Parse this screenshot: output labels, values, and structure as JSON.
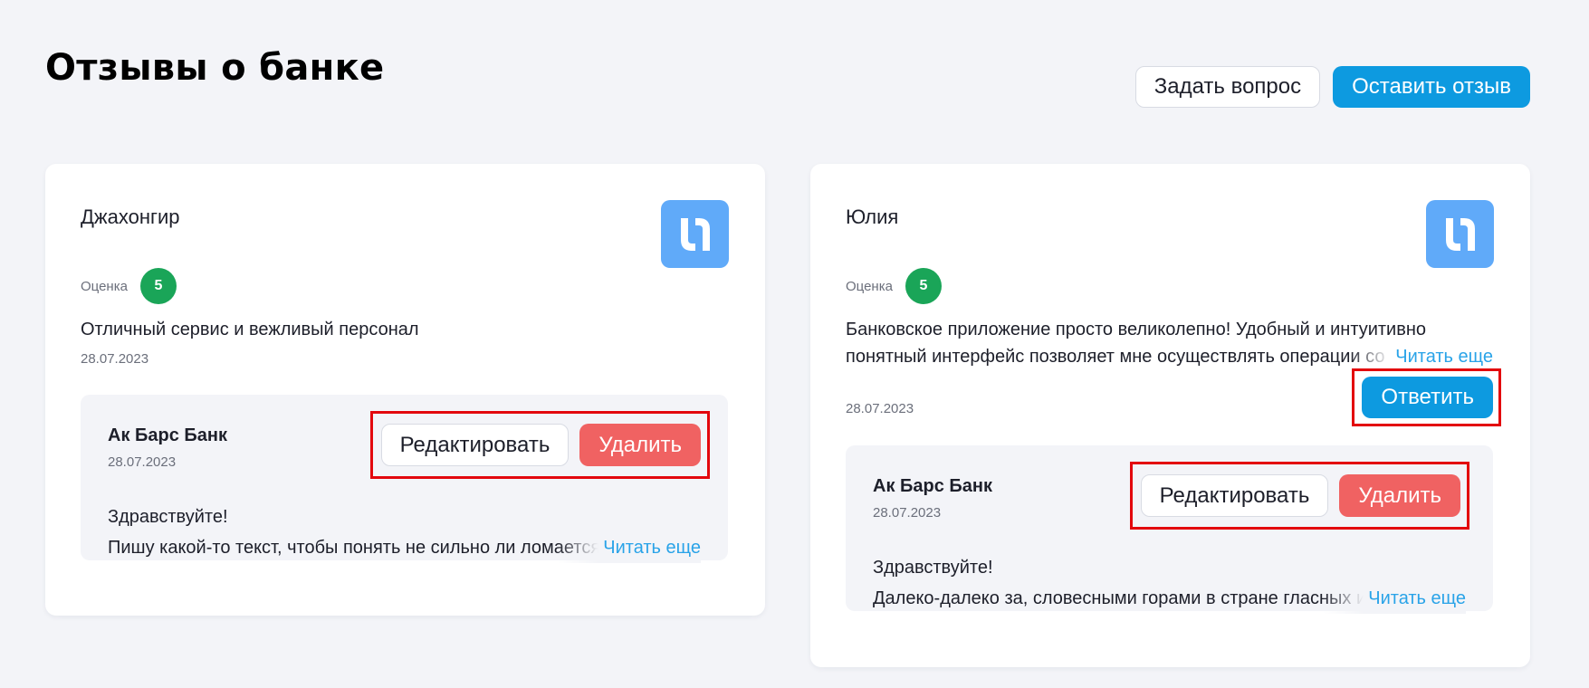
{
  "page": {
    "title": "Отзывы о банке",
    "ask_button": "Задать вопрос",
    "leave_review_button": "Оставить отзыв"
  },
  "reviews": [
    {
      "author": "Джахонгир",
      "rating_label": "Оценка",
      "rating": "5",
      "text_line1": "Отличный сервис и вежливый персонал",
      "date": "28.07.2023",
      "reply": {
        "bank_name": "Ак Барс Банк",
        "date": "28.07.2023",
        "edit_label": "Редактировать",
        "delete_label": "Удалить",
        "greeting": "Здравствуйте!",
        "text_line": "Пишу какой-то текст, чтобы понять не сильно ли ломается верстка",
        "read_more": "Читать еще"
      }
    },
    {
      "author": "Юлия",
      "rating_label": "Оценка",
      "rating": "5",
      "text_line1": "Банковское приложение просто великолепно! Удобный и интуитивно",
      "text_line2": "понятный интерфейс позволяет мне осуществлять операции со",
      "read_more": "Читать еще",
      "answer_label": "Ответить",
      "date": "28.07.2023",
      "reply": {
        "bank_name": "Ак Барс Банк",
        "date": "28.07.2023",
        "edit_label": "Редактировать",
        "delete_label": "Удалить",
        "greeting": "Здравствуйте!",
        "text_line": "Далеко-далеко за, словесными горами в стране гласных и согласных",
        "read_more": "Читать еще"
      }
    }
  ],
  "colors": {
    "primary": "#0d9ae0",
    "danger": "#f06262",
    "rating_badge": "#1aa558",
    "logo_bg": "#60aaf9",
    "highlight": "#e3070d",
    "link": "#29a3e8"
  },
  "icons": {
    "logo": "bank-logo-icon"
  }
}
